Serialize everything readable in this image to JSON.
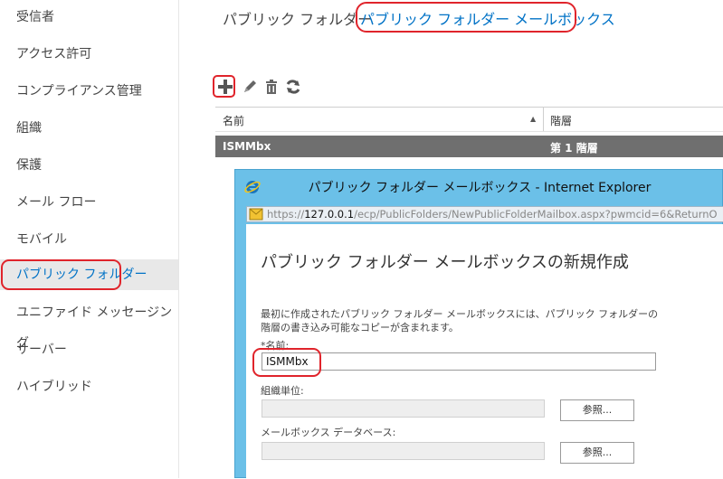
{
  "nav": {
    "items": [
      {
        "label": "受信者"
      },
      {
        "label": "アクセス許可"
      },
      {
        "label": "コンプライアンス管理"
      },
      {
        "label": "組織"
      },
      {
        "label": "保護"
      },
      {
        "label": "メール フロー"
      },
      {
        "label": "モバイル"
      },
      {
        "label": "パブリック フォルダー",
        "selected": true
      },
      {
        "label": "ユニファイド メッセージング"
      },
      {
        "label": "サーバー"
      },
      {
        "label": "ハイブリッド"
      }
    ]
  },
  "tabs": {
    "folders": "パブリック フォルダー",
    "mailboxes": "パブリック フォルダー メールボックス",
    "active": "mailboxes"
  },
  "toolbar": {
    "icons": [
      "plus-icon",
      "pencil-icon",
      "trash-icon",
      "refresh-icon"
    ]
  },
  "grid": {
    "columns": [
      "名前",
      "階層"
    ],
    "rows": [
      {
        "name": "ISMMbx",
        "level": "第 1 階層"
      }
    ]
  },
  "window": {
    "title": "パブリック フォルダー メールボックス - Internet Explorer",
    "url_prefix": "https://",
    "url_host": "127.0.0.1",
    "url_path": "/ecp/PublicFolders/NewPublicFolderMailbox.aspx?pwmcid=6&ReturnO"
  },
  "dialog": {
    "title": "パブリック フォルダー メールボックスの新規作成",
    "description": "最初に作成されたパブリック フォルダー メールボックスには、パブリック フォルダーの階層の書き込み可能なコピーが含まれます。",
    "name_label": "*名前:",
    "name_value": "ISMMbx",
    "ou_label": "組織単位:",
    "ou_value": "",
    "db_label": "メールボックス データベース:",
    "db_value": "",
    "browse_label": "参照..."
  },
  "colors": {
    "accent": "#0072c6",
    "highlight_ring": "#e0242b",
    "selected_row": "#6f6f6f",
    "ie_frame": "#6bc0e8"
  }
}
